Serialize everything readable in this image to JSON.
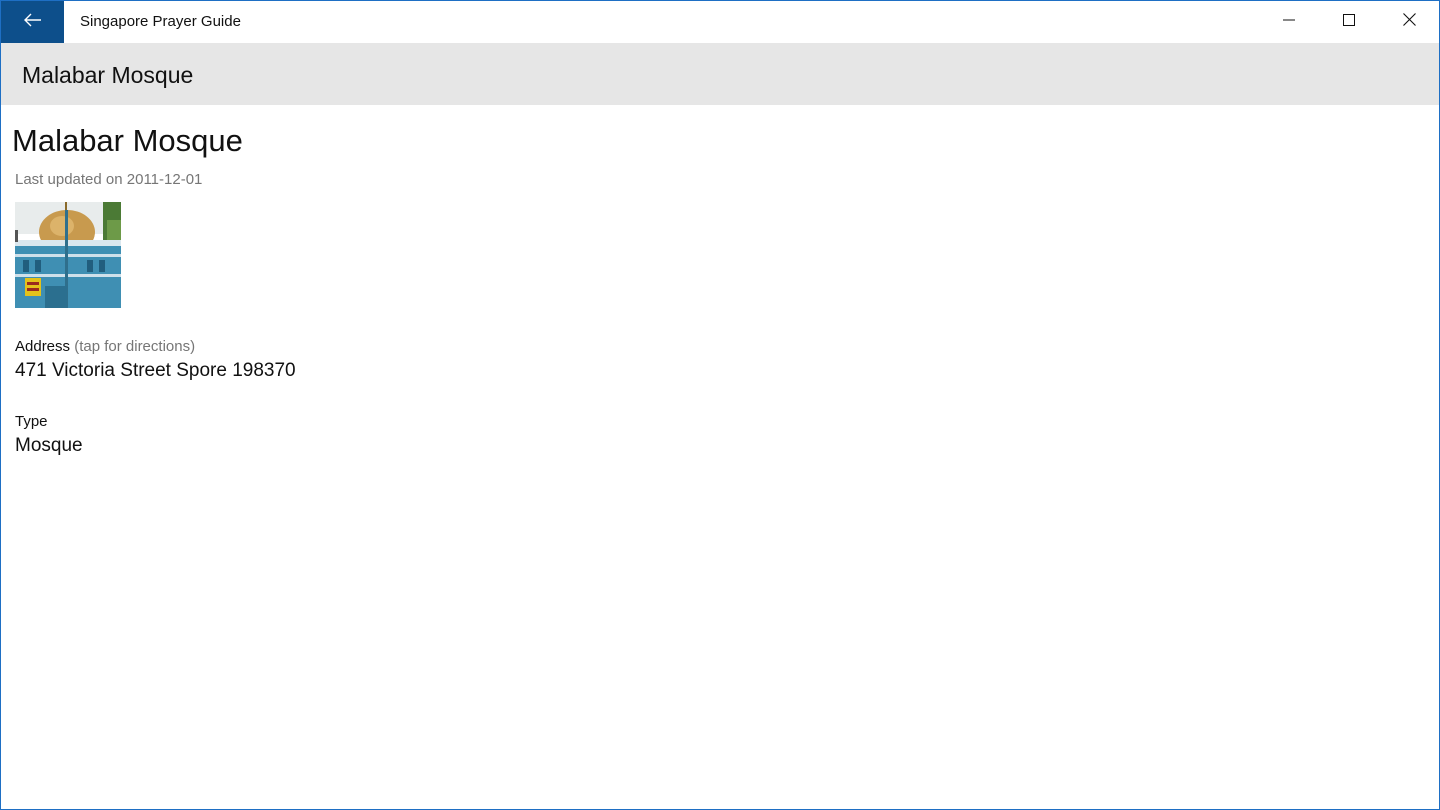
{
  "window": {
    "app_title": "Singapore Prayer Guide",
    "back_icon": "arrow-left-icon",
    "controls": [
      "minimize-icon",
      "maximize-icon",
      "close-icon"
    ],
    "accent_color": "#0d4f8b"
  },
  "header": {
    "title": "Malabar Mosque"
  },
  "place": {
    "name": "Malabar Mosque",
    "last_updated": "Last updated on 2011-12-01",
    "address_label": "Address",
    "address_hint": "(tap for directions)",
    "address_value": "471 Victoria Street Spore 198370",
    "type_label": "Type",
    "type_value": "Mosque"
  }
}
